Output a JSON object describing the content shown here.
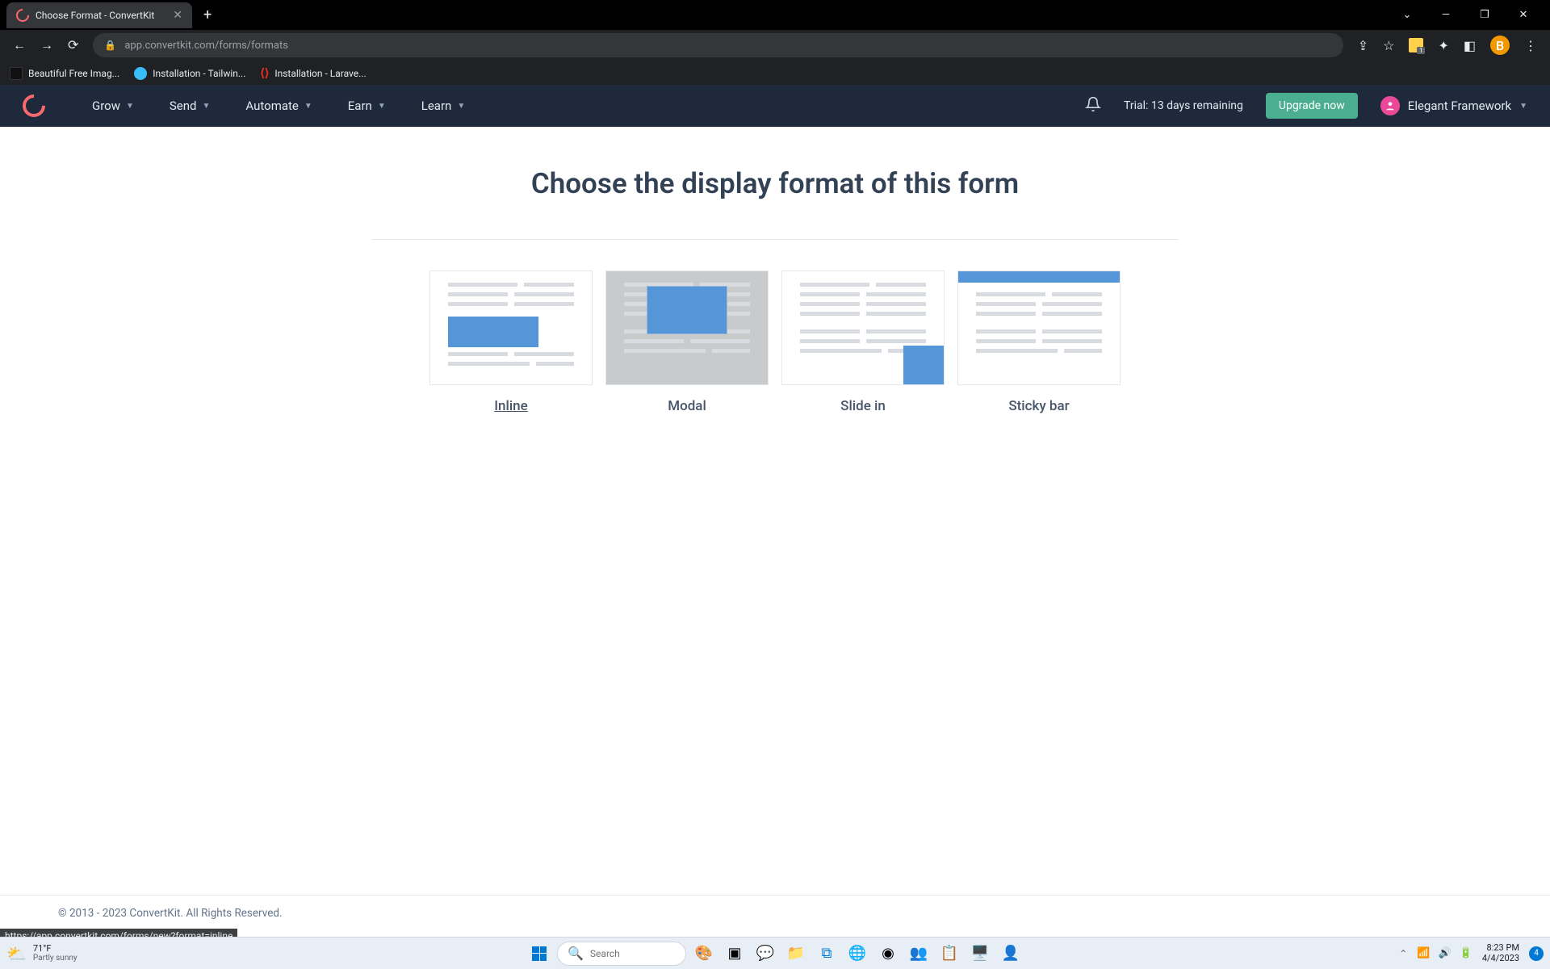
{
  "browser": {
    "tab_title": "Choose Format - ConvertKit",
    "url": "app.convertkit.com/forms/formats",
    "bookmarks": [
      {
        "label": "Beautiful Free Imag..."
      },
      {
        "label": "Installation - Tailwin..."
      },
      {
        "label": "Installation - Larave..."
      }
    ],
    "profile_letter": "B",
    "status_url": "https://app.convertkit.com/forms/new?format=inline"
  },
  "app_nav": {
    "items": [
      "Grow",
      "Send",
      "Automate",
      "Earn",
      "Learn"
    ],
    "trial_text": "Trial: 13 days remaining",
    "upgrade_label": "Upgrade now",
    "user_name": "Elegant Framework"
  },
  "page": {
    "title": "Choose the display format of this form",
    "formats": [
      {
        "label": "Inline",
        "selected": true
      },
      {
        "label": "Modal",
        "selected": false
      },
      {
        "label": "Slide in",
        "selected": false
      },
      {
        "label": "Sticky bar",
        "selected": false
      }
    ],
    "footer": "© 2013 - 2023 ConvertKit. All Rights Reserved."
  },
  "taskbar": {
    "weather_temp": "71°F",
    "weather_cond": "Partly sunny",
    "search_placeholder": "Search",
    "time": "8:23 PM",
    "date": "4/4/2023",
    "notif_count": "4"
  }
}
